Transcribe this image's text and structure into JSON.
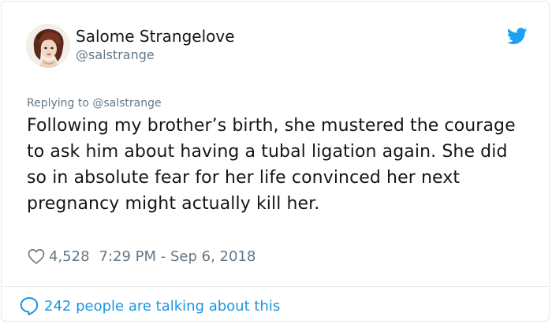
{
  "author": {
    "display_name": "Salome Strangelove",
    "handle": "@salstrange"
  },
  "tweet": {
    "reply_to": "Replying to @salstrange",
    "text": "Following my brother’s birth, she mustered the courage to ask him about having a tubal ligation again. She did so in absolute fear for her life convinced her next pregnancy might actually kill her.",
    "likes": "4,528",
    "timestamp": "7:29 PM - Sep 6, 2018"
  },
  "footer": {
    "conversation": "242 people are talking about this"
  },
  "icons": {
    "brand": "twitter-bird-icon",
    "like": "heart-outline-icon",
    "conversation": "speech-bubble-icon"
  },
  "colors": {
    "brand_blue": "#1da1f2",
    "link_blue": "#1b95e0",
    "secondary_text": "#657786",
    "primary_text": "#14171a",
    "border": "#e1e8ed"
  }
}
